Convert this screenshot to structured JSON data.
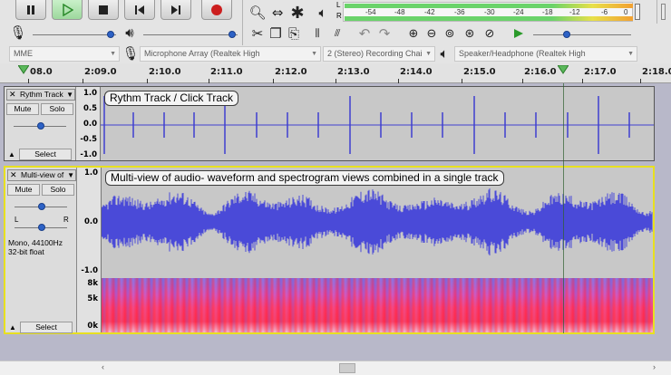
{
  "transport": {
    "pause": "pause-icon",
    "play": "play-icon",
    "stop": "stop-icon",
    "skip_start": "skip-to-start-icon",
    "skip_end": "skip-to-end-icon",
    "record": "record-icon"
  },
  "meter": {
    "left_channel": "L",
    "right_channel": "R",
    "scale": [
      "-54",
      "-48",
      "-42",
      "-36",
      "-30",
      "-24",
      "-18",
      "-12",
      "-6",
      "0"
    ],
    "colors": {
      "green": "#6ad36a",
      "yellow": "#e8e04a",
      "orange": "#f2a030"
    }
  },
  "devices": {
    "host": "MME",
    "recording_device": "Microphone Array (Realtek High",
    "channels": "2 (Stereo) Recording Chai",
    "playback_device": "Speaker/Headphone (Realtek High"
  },
  "timeline": {
    "ticks": [
      "08.0",
      "2:09.0",
      "2:10.0",
      "2:11.0",
      "2:12.0",
      "2:13.0",
      "2:14.0",
      "2:15.0",
      "2:16.0",
      "2:17.0",
      "2:18.0"
    ]
  },
  "tracks": [
    {
      "name": "Rythm Track",
      "title": "Rythm Track / Click Track",
      "mute": "Mute",
      "solo": "Solo",
      "select": "Select",
      "scale": [
        "1.0",
        "0.5",
        "0.0",
        "-0.5",
        "-1.0"
      ],
      "waveform_color": "#3f3fd0"
    },
    {
      "name": "Multi-view of",
      "title": "Multi-view of audio- waveform and spectrogram views combined in a single track",
      "mute": "Mute",
      "solo": "Solo",
      "select": "Select",
      "pan_left": "L",
      "pan_right": "R",
      "format": "Mono, 44100Hz",
      "bit_depth": "32-bit float",
      "scale": [
        "1.0",
        "0.0",
        "-1.0"
      ],
      "spectrogram_scale": [
        "8k",
        "5k",
        "0k"
      ],
      "waveform_color": "#4a4ad8",
      "selected_border_color": "#e8e020"
    }
  ]
}
